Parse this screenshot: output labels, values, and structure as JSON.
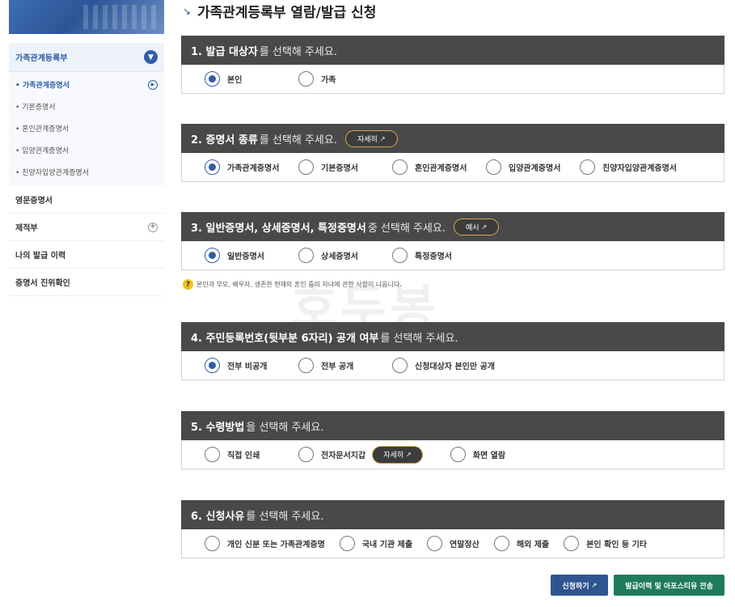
{
  "sidebar": {
    "header": "가족관계등록부",
    "sub_items": [
      {
        "label": "• 가족관계증명서",
        "active": true
      },
      {
        "label": "• 기본증명서"
      },
      {
        "label": "• 혼인관계증명서"
      },
      {
        "label": "• 입양관계증명서"
      },
      {
        "label": "• 친양자입양관계증명서"
      }
    ],
    "items": [
      {
        "label": "영문증명서"
      },
      {
        "label": "제적부"
      },
      {
        "label": "나의 발급 이력"
      },
      {
        "label": "증명서 진위확인"
      }
    ]
  },
  "page": {
    "title": "가족관계등록부 열람/발급 신청"
  },
  "sections": [
    {
      "num_strong": "1. 발급 대상자",
      "rest": "를 선택해 주세요.",
      "options": [
        "본인",
        "가족"
      ],
      "selected": 0
    },
    {
      "num_strong": "2. 증명서 종류",
      "rest": "를 선택해 주세요.",
      "pill": "자세히",
      "options": [
        "가족관계증명서",
        "기본증명서",
        "혼인관계증명서",
        "입양관계증명서",
        "친양자입양관계증명서"
      ],
      "selected": 0
    },
    {
      "num_strong": "3. 일반증명서, 상세증명서, 특정증명서",
      "rest": " 중 선택해 주세요.",
      "pill": "예시",
      "options": [
        "일반증명서",
        "상세증명서",
        "특정증명서"
      ],
      "selected": 0
    },
    {
      "num_strong": "4. 주민등록번호(뒷부분 6자리) 공개 여부",
      "rest": "를 선택해 주세요.",
      "options": [
        "전부 비공개",
        "전부 공개",
        "신청대상자 본인만 공개"
      ],
      "selected": 0
    },
    {
      "num_strong": "5. 수령방법",
      "rest": "을 선택해 주세요.",
      "inline_pill": "자세히",
      "options": [
        "직접 인쇄",
        "전자문서지갑",
        "화면 열람"
      ],
      "selected": -1
    },
    {
      "num_strong": "6. 신청사유",
      "rest": "를 선택해 주세요.",
      "options": [
        "개인 신분 또는 가족관계증명",
        "국내 기관 제출",
        "연말정산",
        "해외 제출",
        "본인 확인 등 기타"
      ],
      "selected": -1
    }
  ],
  "note": "본인과 부모, 배우자, 생존한 현재의 혼인 중의 자녀에 관한 사항이 나옵니다.",
  "watermark": "호두봉",
  "buttons": {
    "apply": "신청하기",
    "history": "발급이력 및 아포스티유 전송"
  },
  "icons": {
    "external": "↗",
    "chevron": "▾"
  },
  "colors": {
    "accent": "#2f5ea8",
    "section_header": "#494949",
    "pill_border": "#d6a84a",
    "apply_button": "#2f5590",
    "history_button": "#1f7a5e"
  }
}
